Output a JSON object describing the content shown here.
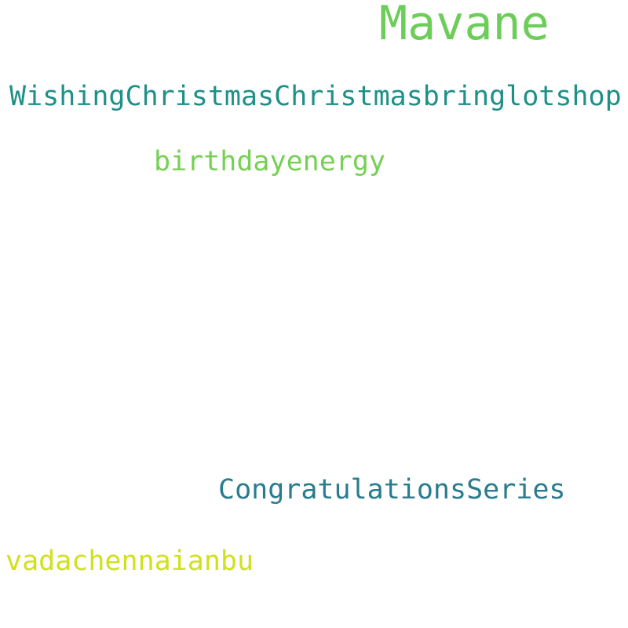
{
  "word_cloud": {
    "words": [
      {
        "text": "Mavane",
        "color": "#6ccd59"
      },
      {
        "text": "WishingChristmasChristmasbringlotshop",
        "color": "#1f9088"
      },
      {
        "text": "birthdayenergy",
        "color": "#75d054"
      },
      {
        "text": "CongratulationsSeries",
        "color": "#287c8e"
      },
      {
        "text": "vadachennaianbu",
        "color": "#d0e11c"
      }
    ]
  }
}
